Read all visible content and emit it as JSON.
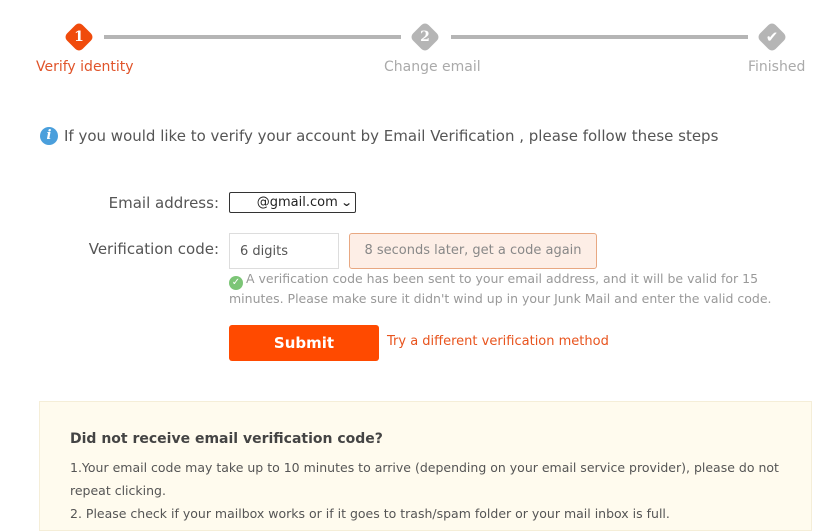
{
  "stepper": {
    "steps": [
      {
        "number": "1",
        "label": "Verify identity",
        "state": "active",
        "icon": "number"
      },
      {
        "number": "2",
        "label": "Change email",
        "state": "pending",
        "icon": "number"
      },
      {
        "number": "",
        "label": "Finished",
        "state": "pending",
        "icon": "checkmark-icon"
      }
    ],
    "colors": {
      "active": "#f04b0c",
      "pending": "#b5b5b5",
      "active_label": "#e0542a",
      "pending_label": "#aaaaaa"
    }
  },
  "info": {
    "icon": "info-icon",
    "text": "If you would like to verify your account by Email Verification , please follow these steps"
  },
  "form": {
    "email_label": "Email address:",
    "email_value": "@gmail.com",
    "code_label": "Verification code:",
    "code_placeholder": "6 digits",
    "resend_label": "8 seconds later, get a code again",
    "sent_message": "A verification code has been sent to your email address, and it will be valid for 15 minutes. Please make sure it didn't wind up in your Junk Mail and enter the valid code.",
    "submit_label": "Submit",
    "alt_method_label": "Try a different verification method"
  },
  "help": {
    "title": "Did not receive email verification code?",
    "items": [
      "1.Your email code may take up to 10 minutes to arrive (depending on your email service provider), please do not repeat clicking.",
      "2. Please check if your mailbox works or if it goes to trash/spam folder or your mail inbox is full."
    ]
  },
  "colors": {
    "accent": "#ff4a00",
    "help_bg": "#fffbee"
  }
}
